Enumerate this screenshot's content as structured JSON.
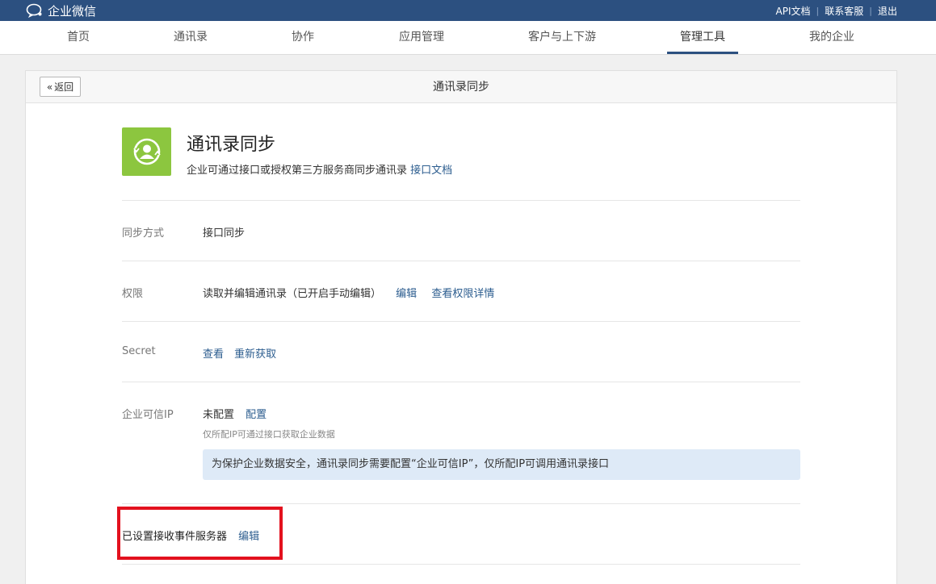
{
  "header": {
    "brand": "企业微信",
    "links": [
      "API文档",
      "联系客服",
      "退出"
    ],
    "brand_color": "#2c5080"
  },
  "nav": {
    "items": [
      "首页",
      "通讯录",
      "协作",
      "应用管理",
      "客户与上下游",
      "管理工具",
      "我的企业"
    ],
    "active": "管理工具"
  },
  "page": {
    "back_label": "返回",
    "title": "通讯录同步"
  },
  "app": {
    "icon": "contacts-sync-icon",
    "icon_color": "#8cc63f",
    "name": "通讯录同步",
    "description": "企业可通过接口或授权第三方服务商同步通讯录",
    "doc_link": "接口文档"
  },
  "rows": {
    "sync_mode": {
      "label": "同步方式",
      "value": "接口同步"
    },
    "permission": {
      "label": "权限",
      "value": "读取并编辑通讯录（已开启手动编辑）",
      "edit": "编辑",
      "details": "查看权限详情"
    },
    "secret": {
      "label": "Secret",
      "view": "查看",
      "refresh": "重新获取"
    },
    "trusted_ip": {
      "label": "企业可信IP",
      "status": "未配置",
      "configure": "配置",
      "hint": "仅所配IP可通过接口获取企业数据",
      "notice": "为保护企业数据安全，通讯录同步需要配置“企业可信IP”，仅所配IP可调用通讯录接口"
    }
  },
  "event_server": {
    "text": "已设置接收事件服务器",
    "edit": "编辑",
    "highlight_color": "#e3111e"
  }
}
